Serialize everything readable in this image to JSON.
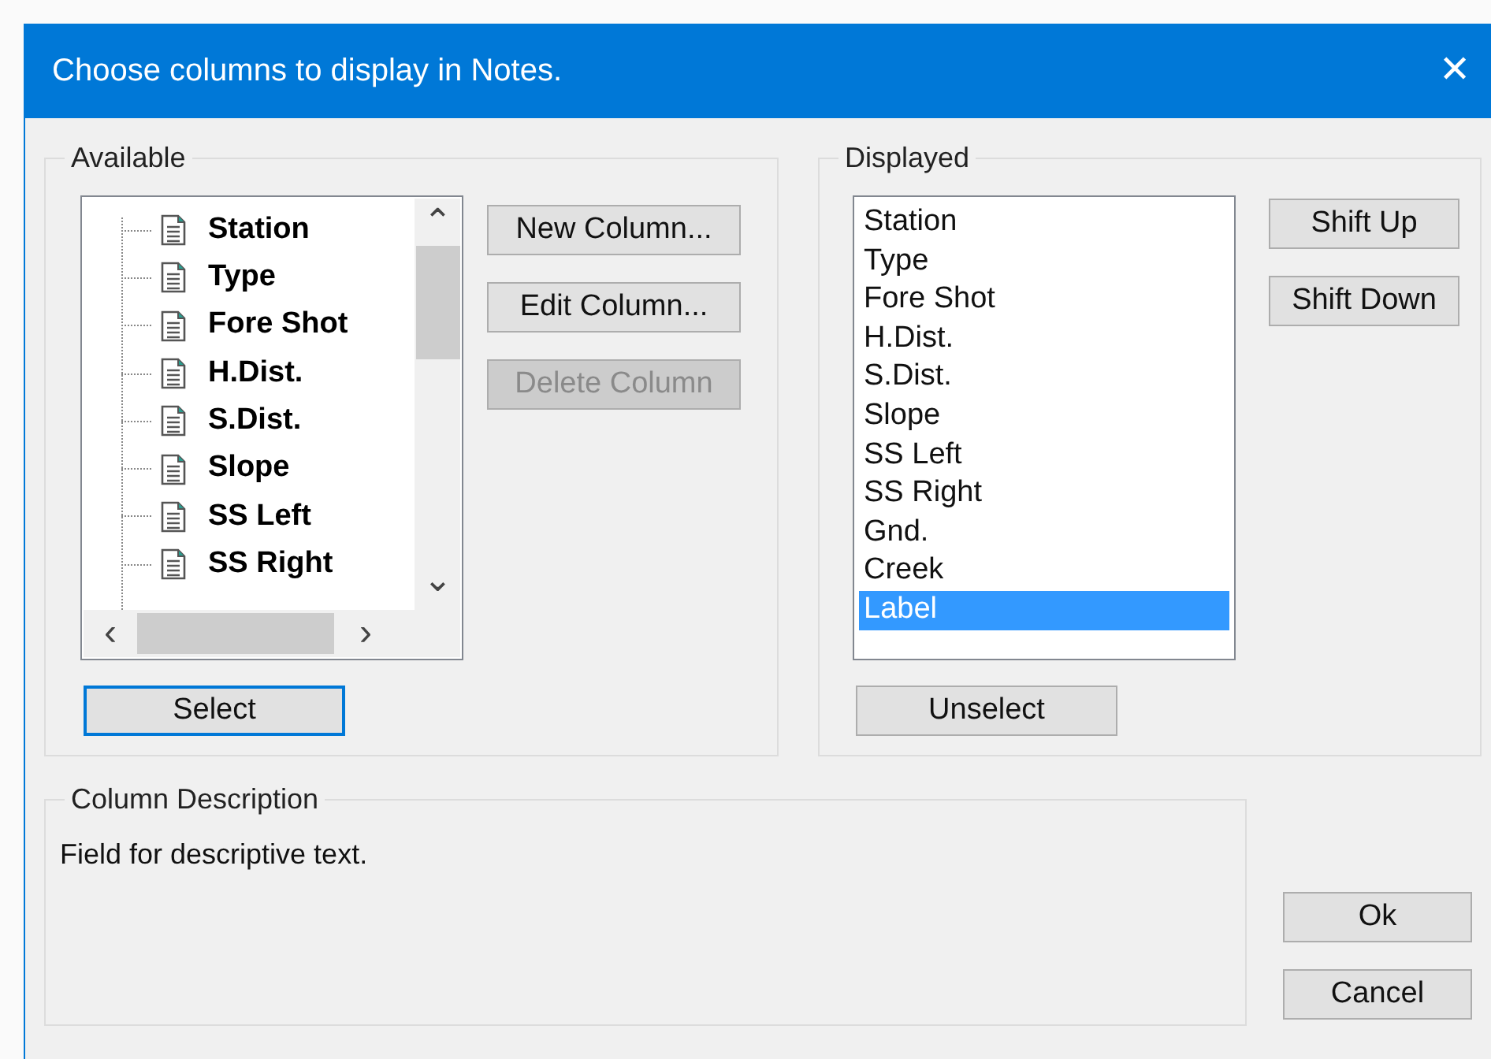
{
  "window": {
    "title": "Choose columns to display in Notes.",
    "close": "✕"
  },
  "available": {
    "label": "Available",
    "items": [
      "Station",
      "Type",
      "Fore Shot",
      "H.Dist.",
      "S.Dist.",
      "Slope",
      "SS Left",
      "SS Right"
    ],
    "scroll_up": "⌃",
    "scroll_down": "⌄",
    "scroll_left": "‹",
    "scroll_right": "›",
    "buttons": [
      {
        "label": "New Column...",
        "disabled": false
      },
      {
        "label": "Edit Column...",
        "disabled": false
      },
      {
        "label": "Delete Column",
        "disabled": true
      }
    ],
    "select": "Select"
  },
  "displayed": {
    "label": "Displayed",
    "items": [
      {
        "label": "Station",
        "selected": false
      },
      {
        "label": "Type",
        "selected": false
      },
      {
        "label": "Fore Shot",
        "selected": false
      },
      {
        "label": "H.Dist.",
        "selected": false
      },
      {
        "label": "S.Dist.",
        "selected": false
      },
      {
        "label": "Slope",
        "selected": false
      },
      {
        "label": "SS Left",
        "selected": false
      },
      {
        "label": "SS Right",
        "selected": false
      },
      {
        "label": "Gnd.",
        "selected": false
      },
      {
        "label": "Creek",
        "selected": false
      },
      {
        "label": "Label",
        "selected": true
      }
    ],
    "buttons": [
      "Shift Up",
      "Shift Down"
    ],
    "unselect": "Unselect"
  },
  "description": {
    "label": "Column Description",
    "text": "Field for descriptive text."
  },
  "buttons": [
    "Ok",
    "Cancel"
  ]
}
